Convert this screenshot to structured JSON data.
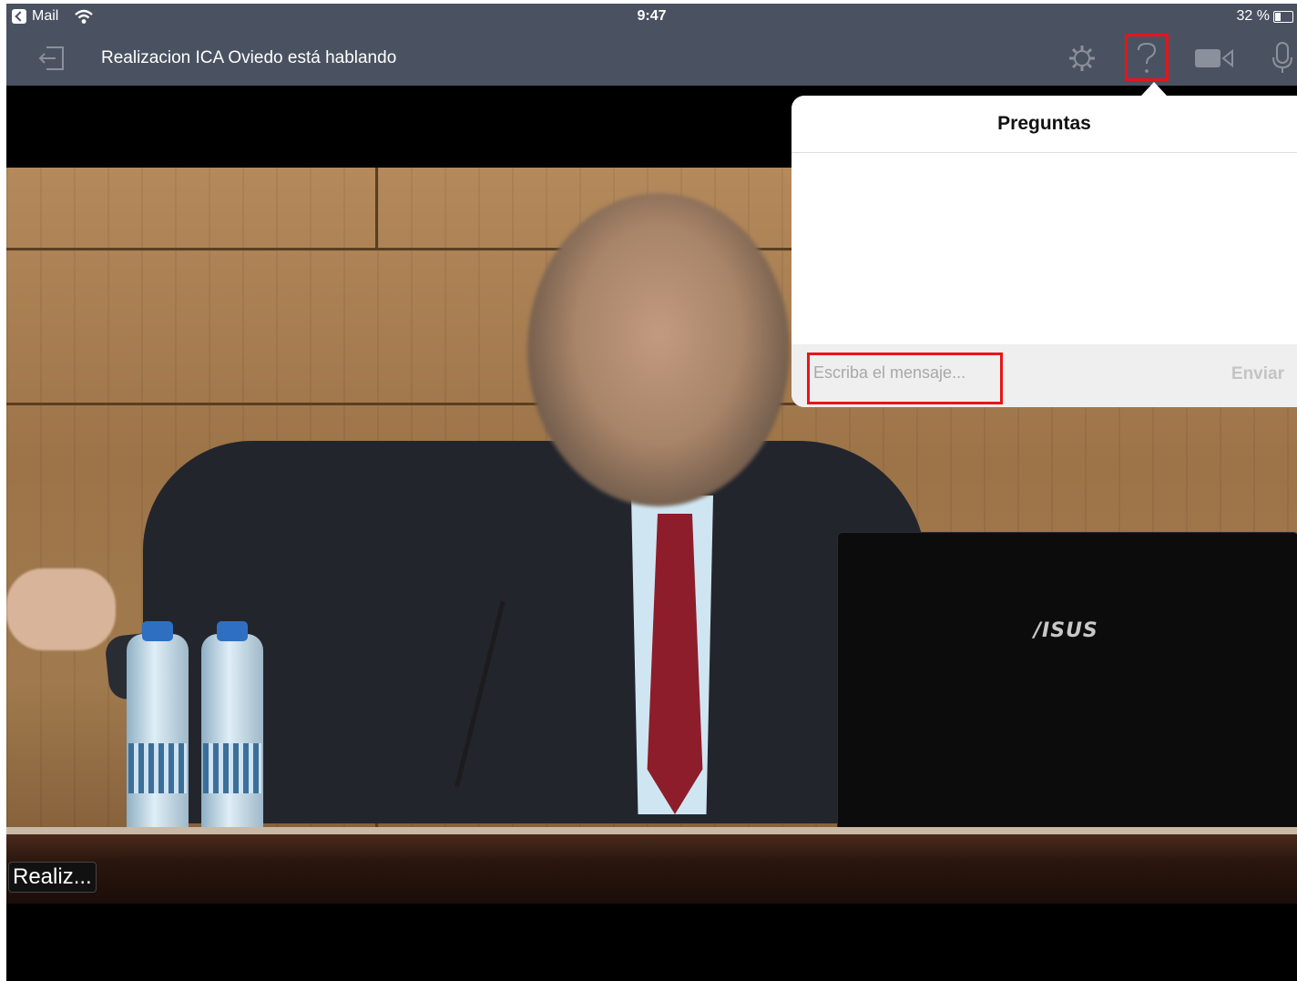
{
  "status_bar": {
    "back_app": "Mail",
    "time": "9:47",
    "battery": "32 %",
    "battery_level_percent": 32
  },
  "toolbar": {
    "speaker_status": "Realizacion ICA Oviedo está hablando",
    "icons": [
      "exit-icon",
      "settings-icon",
      "question-icon",
      "camera-icon",
      "microphone-icon"
    ],
    "active_icon": "question-icon",
    "highlight_color": "#e8141b"
  },
  "video": {
    "participant_tag": "Realiz...",
    "laptop_brand": "/ISUS"
  },
  "questions_panel": {
    "title": "Preguntas",
    "input_placeholder": "Escriba el mensaje...",
    "input_value": "",
    "send_label": "Enviar"
  },
  "colors": {
    "toolbar_bg": "#4a5261",
    "panel_footer_bg": "#efefef"
  }
}
